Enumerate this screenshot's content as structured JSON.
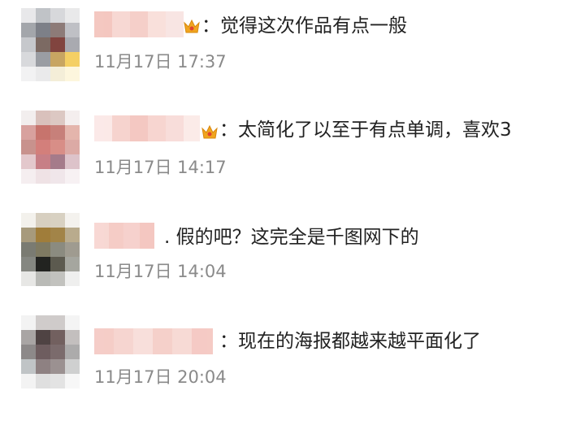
{
  "comments": [
    {
      "text": "：觉得这次作品有点一般",
      "time": "11月17日 17:37",
      "badge": "crown-badge"
    },
    {
      "text": "：太简化了以至于有点单调，喜欢3",
      "time": "11月17日 14:17",
      "badge": "crown-badge"
    },
    {
      "text": ". 假的吧？这完全是千图网下的",
      "time": "11月17日 14:04",
      "badge": ""
    },
    {
      "text": "：现在的海报都越来越平面化了",
      "time": "11月17日 20:04",
      "badge": ""
    }
  ],
  "colors": {
    "text": "#222222",
    "time": "#8a8a8a",
    "name_blur": "#f6c9c3",
    "crown": "#f0a51e"
  }
}
